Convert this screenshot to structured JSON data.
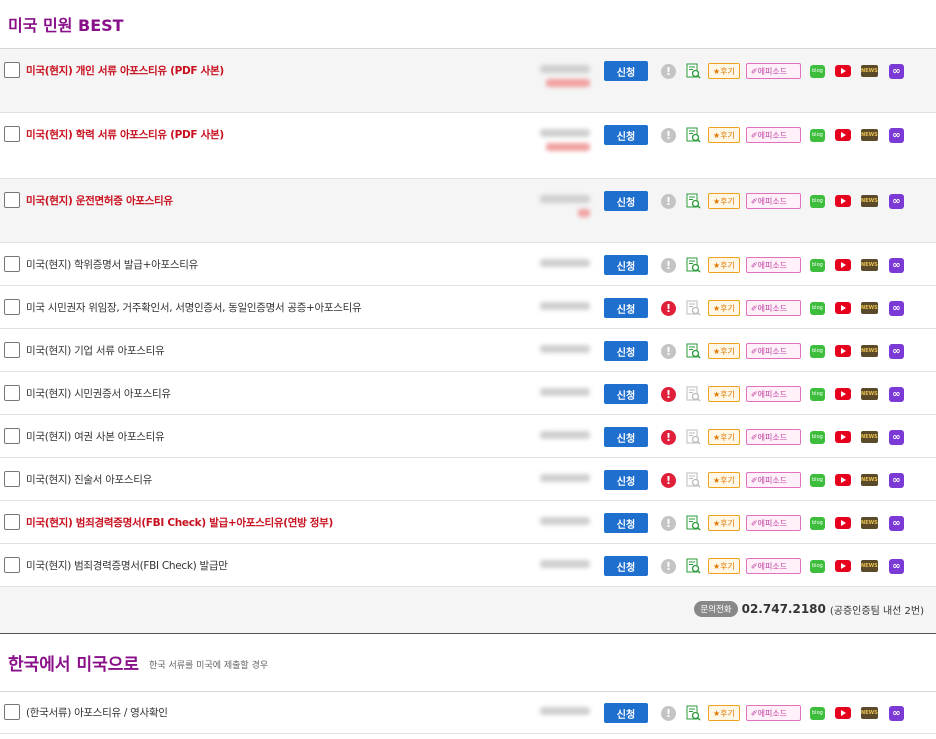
{
  "section1": {
    "title": "미국 민원 BEST",
    "rows": [
      {
        "name": "미국(현지) 개인 서류 아포스티유 (PDF 사본)",
        "red": true,
        "warn": "grey",
        "shaded": true,
        "price2": true
      },
      {
        "name": "미국(현지) 학력 서류 아포스티유 (PDF 사본)",
        "red": true,
        "warn": "grey",
        "shaded": false,
        "price2": true
      },
      {
        "name": "미국(현지) 운전면허증 아포스티유",
        "red": true,
        "warn": "grey",
        "shaded": true,
        "price2": true
      },
      {
        "name": "미국(현지) 학위증명서 발급+아포스티유",
        "red": false,
        "warn": "grey",
        "shaded": false
      },
      {
        "name": "미국 시민권자 위임장, 거주확인서, 서명인증서, 동일인증명서 공증+아포스티유",
        "red": false,
        "warn": "red",
        "shaded": false
      },
      {
        "name": "미국(현지) 기업 서류 아포스티유",
        "red": false,
        "warn": "grey",
        "shaded": false
      },
      {
        "name": "미국(현지) 시민권증서 아포스티유",
        "red": false,
        "warn": "red",
        "shaded": false
      },
      {
        "name": "미국(현지) 여권 사본 아포스티유",
        "red": false,
        "warn": "red",
        "shaded": false
      },
      {
        "name": "미국(현지) 진술서 아포스티유",
        "red": false,
        "warn": "red",
        "shaded": false
      },
      {
        "name": "미국(현지) 범죄경력증명서(FBI Check) 발급+아포스티유(연방 정부)",
        "red": true,
        "warn": "grey",
        "shaded": false
      },
      {
        "name": "미국(현지) 범죄경력증명서(FBI Check) 발급만",
        "red": false,
        "warn": "grey",
        "shaded": false
      }
    ]
  },
  "labels": {
    "apply": "신청",
    "review": "★후기",
    "episode": "✐에피소드",
    "blog": "blog",
    "news": "NEWS",
    "warn": "!",
    "link": "∞"
  },
  "phone": {
    "badge": "문의전화",
    "number": "02.747.2180",
    "note": "(공증인증팀 내선 2번)"
  },
  "section2": {
    "title": "한국에서 미국으로",
    "subtitle": "한국 서류를 미국에 제출할 경우",
    "rows": [
      {
        "name": "(한국서류) 아포스티유 / 영사확인",
        "red": false,
        "warn": "grey",
        "shaded": false
      }
    ]
  },
  "colors": {
    "title": "#8a108a",
    "apply": "#1f6fcf",
    "red_text": "#c8101e"
  }
}
